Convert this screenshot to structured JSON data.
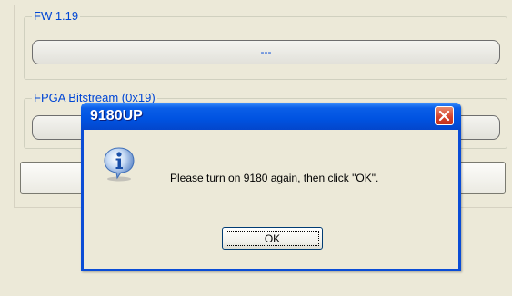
{
  "background_window": {
    "group1": {
      "legend": "FW 1.19",
      "progress_text": "---"
    },
    "group2": {
      "legend": "FPGA Bitstream (0x19)",
      "progress_text": ""
    }
  },
  "dialog": {
    "title": "9180UP",
    "message": "Please turn on 9180 again, then click \"OK\".",
    "ok_label": "OK",
    "icon": "info-icon",
    "close_icon": "close-icon"
  },
  "colors": {
    "titlebar": "#0053e1",
    "legend_text": "#0046d5",
    "close_button": "#d4402a",
    "dialog_face": "#ece9d8"
  }
}
